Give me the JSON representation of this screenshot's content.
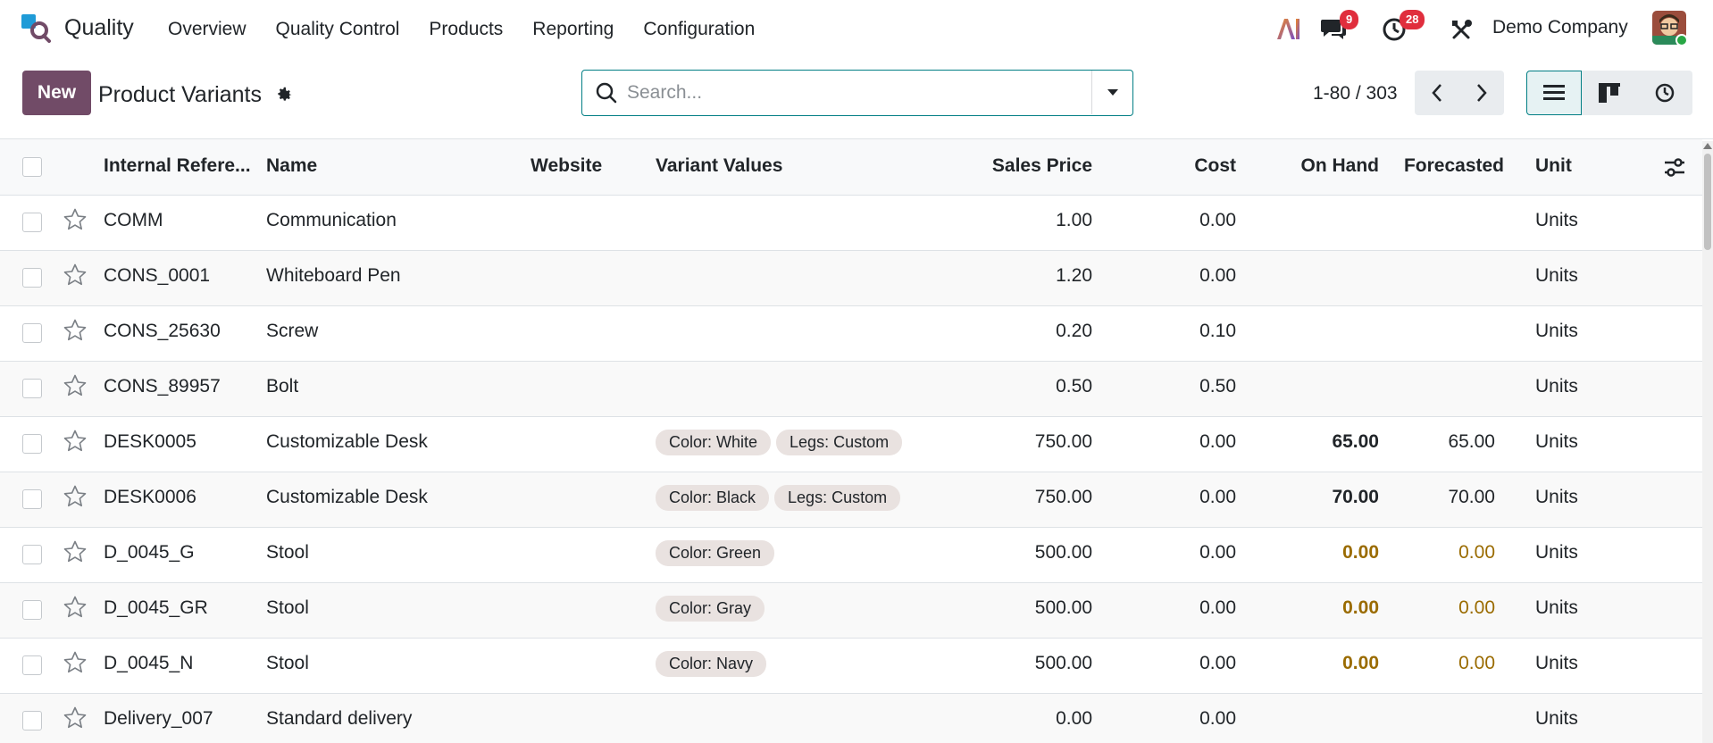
{
  "navbar": {
    "app_name": "Quality",
    "menu": [
      "Overview",
      "Quality Control",
      "Products",
      "Reporting",
      "Configuration"
    ],
    "messages_badge": "9",
    "activities_badge": "28",
    "company": "Demo Company",
    "ai_label": "AI"
  },
  "control": {
    "new_label": "New",
    "title": "Product Variants",
    "search_placeholder": "Search...",
    "pager": "1-80 / 303"
  },
  "table": {
    "headers": {
      "internal_ref": "Internal Refere...",
      "name": "Name",
      "website": "Website",
      "variant_values": "Variant Values",
      "sales_price": "Sales Price",
      "cost": "Cost",
      "on_hand": "On Hand",
      "forecasted": "Forecasted",
      "unit": "Unit"
    },
    "rows": [
      {
        "ref": "COMM",
        "name": "Communication",
        "tags": [],
        "price": "1.00",
        "cost": "0.00",
        "on_hand": "",
        "forecasted": "",
        "unit": "Units"
      },
      {
        "ref": "CONS_0001",
        "name": "Whiteboard Pen",
        "tags": [],
        "price": "1.20",
        "cost": "0.00",
        "on_hand": "",
        "forecasted": "",
        "unit": "Units"
      },
      {
        "ref": "CONS_25630",
        "name": "Screw",
        "tags": [],
        "price": "0.20",
        "cost": "0.10",
        "on_hand": "",
        "forecasted": "",
        "unit": "Units"
      },
      {
        "ref": "CONS_89957",
        "name": "Bolt",
        "tags": [],
        "price": "0.50",
        "cost": "0.50",
        "on_hand": "",
        "forecasted": "",
        "unit": "Units"
      },
      {
        "ref": "DESK0005",
        "name": "Customizable Desk",
        "tags": [
          "Color: White",
          "Legs: Custom"
        ],
        "price": "750.00",
        "cost": "0.00",
        "on_hand": "65.00",
        "forecasted": "65.00",
        "unit": "Units",
        "style": "bold"
      },
      {
        "ref": "DESK0006",
        "name": "Customizable Desk",
        "tags": [
          "Color: Black",
          "Legs: Custom"
        ],
        "price": "750.00",
        "cost": "0.00",
        "on_hand": "70.00",
        "forecasted": "70.00",
        "unit": "Units",
        "style": "bold"
      },
      {
        "ref": "D_0045_G",
        "name": "Stool",
        "tags": [
          "Color: Green"
        ],
        "price": "500.00",
        "cost": "0.00",
        "on_hand": "0.00",
        "forecasted": "0.00",
        "unit": "Units",
        "style": "warn"
      },
      {
        "ref": "D_0045_GR",
        "name": "Stool",
        "tags": [
          "Color: Gray"
        ],
        "price": "500.00",
        "cost": "0.00",
        "on_hand": "0.00",
        "forecasted": "0.00",
        "unit": "Units",
        "style": "warn"
      },
      {
        "ref": "D_0045_N",
        "name": "Stool",
        "tags": [
          "Color: Navy"
        ],
        "price": "500.00",
        "cost": "0.00",
        "on_hand": "0.00",
        "forecasted": "0.00",
        "unit": "Units",
        "style": "warn"
      },
      {
        "ref": "Delivery_007",
        "name": "Standard delivery",
        "tags": [],
        "price": "0.00",
        "cost": "0.00",
        "on_hand": "",
        "forecasted": "",
        "unit": "Units"
      }
    ]
  },
  "colors": {
    "brand": "#714b67",
    "accent": "#017e84",
    "badge": "#e02e3d",
    "warning_text": "#9a6b00"
  }
}
